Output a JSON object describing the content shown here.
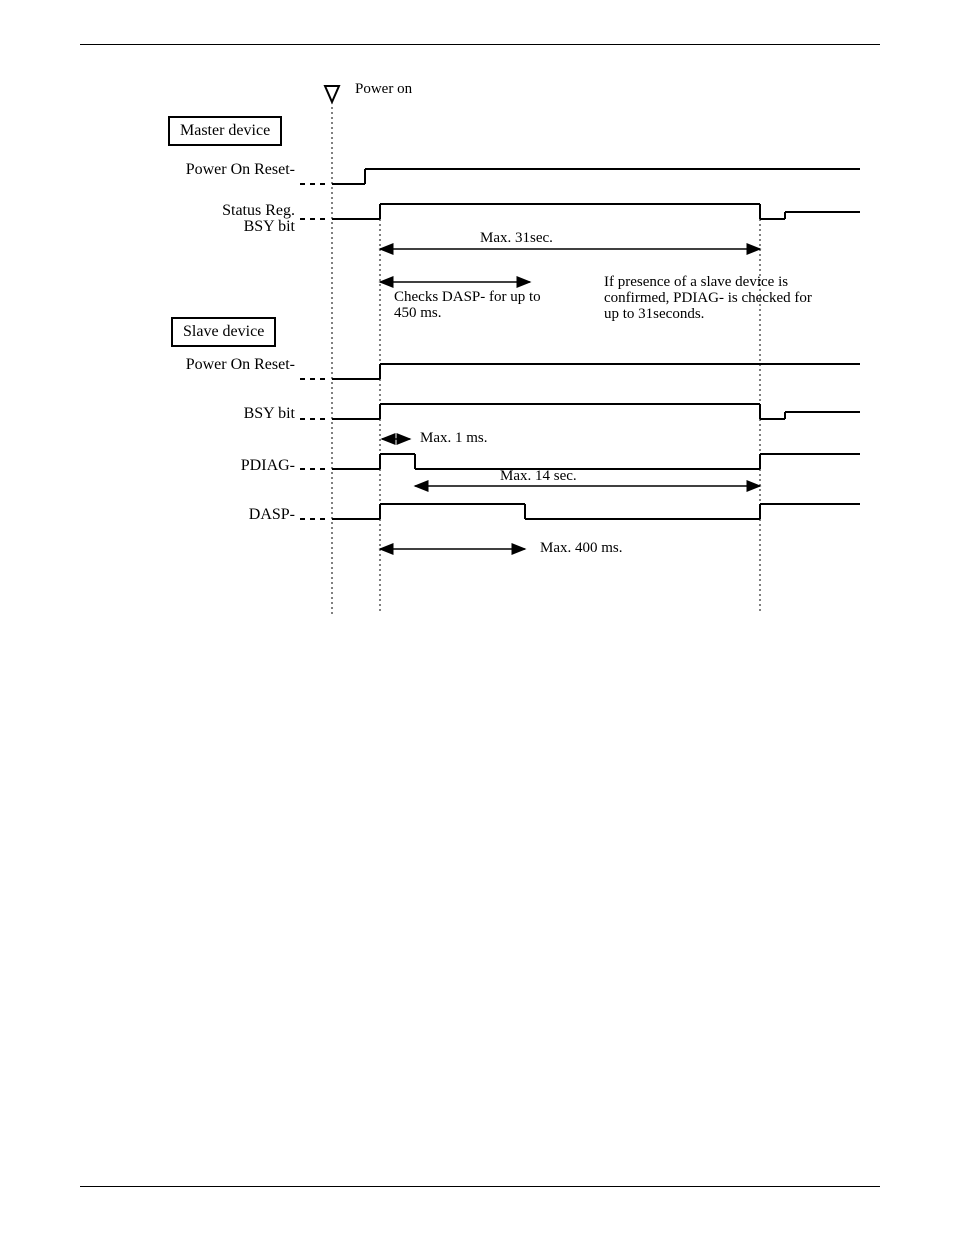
{
  "chart_data": {
    "type": "timing-diagram",
    "event": "Power on",
    "groups": [
      {
        "name": "Master device",
        "signals": [
          {
            "name": "Power On Reset-"
          },
          {
            "name": "Status Reg. BSY bit",
            "notes": [
              "Max. 31sec.",
              "Checks DASP- for up to 450 ms.",
              "If presence of a slave device is confirmed, PDIAG- is checked for up to 31 seconds."
            ]
          }
        ]
      },
      {
        "name": "Slave device",
        "signals": [
          {
            "name": "Power On Reset-"
          },
          {
            "name": "BSY bit",
            "notes": [
              "Max. 1 ms."
            ]
          },
          {
            "name": "PDIAG-",
            "notes": [
              "Max. 14 sec."
            ]
          },
          {
            "name": "DASP-",
            "notes": [
              "Max. 400 ms."
            ]
          }
        ]
      }
    ]
  },
  "text": {
    "power_on": "Power on",
    "master_box": "Master device",
    "slave_box": "Slave device",
    "m_por": "Power On Reset-",
    "m_bsy1": "Status Reg.",
    "m_bsy2": "BSY bit",
    "s_por": "Power On Reset-",
    "s_bsy": "BSY bit",
    "s_pdiag": "PDIAG-",
    "s_dasp": "DASP-",
    "max31": "Max. 31sec.",
    "dasp_check1": "Checks DASP- for up to",
    "dasp_check2": "450 ms.",
    "pdiag_note1": "If presence of a slave device is",
    "pdiag_note2": "confirmed, PDIAG- is checked for",
    "pdiag_note3": "up to 31seconds.",
    "max1ms": "Max. 1 ms.",
    "max14": "Max. 14 sec.",
    "max400": "Max. 400 ms."
  }
}
